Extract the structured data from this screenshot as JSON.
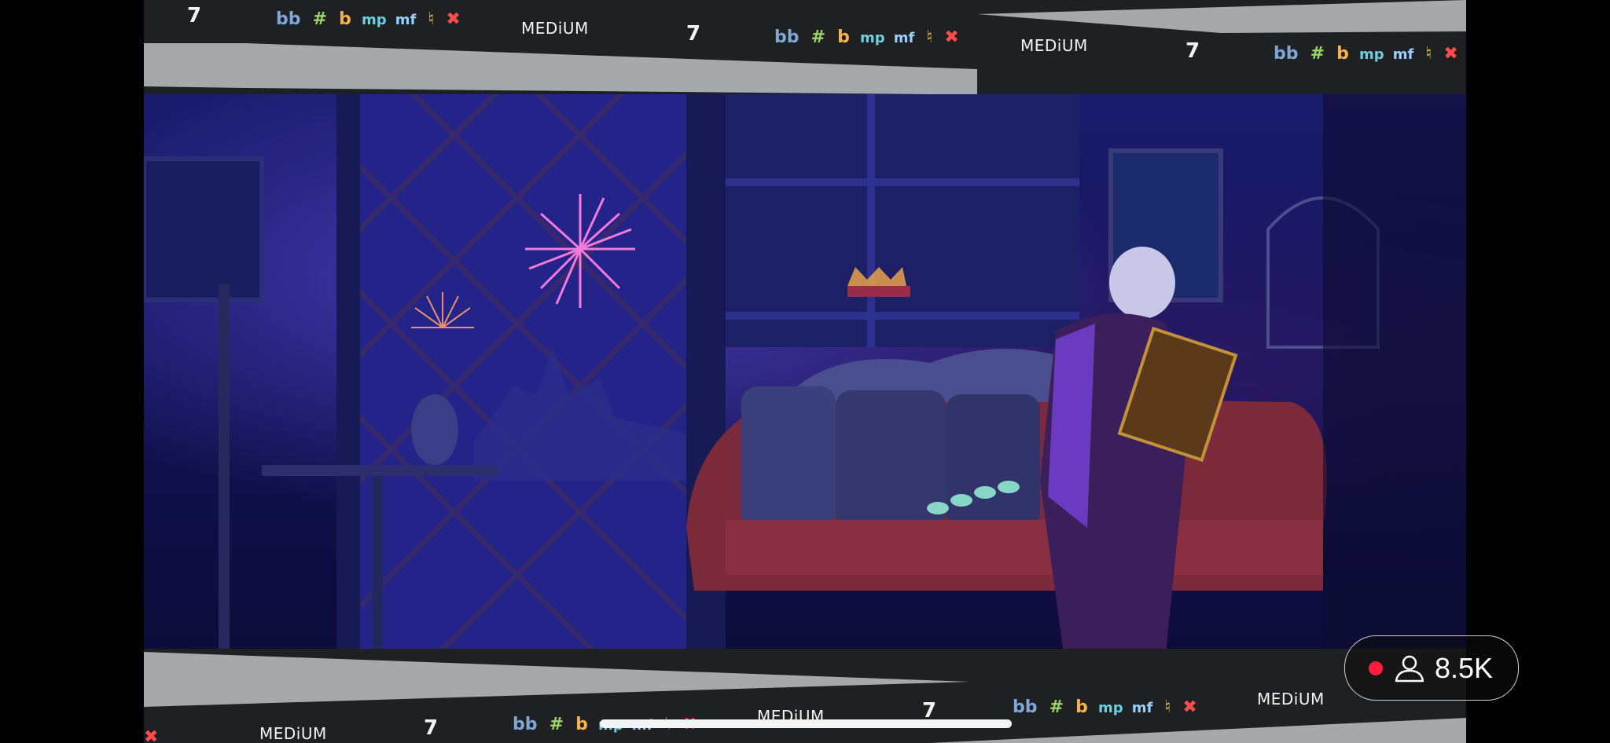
{
  "stream": {
    "viewer_count": "8.5K",
    "live_color": "#ff1f3d",
    "icons": [
      "live-dot-icon",
      "person-icon"
    ]
  },
  "overlay": {
    "medium_label": "MEDiUM",
    "seven_glyph": "7",
    "symbols": [
      "bb",
      "#",
      "b",
      "mp",
      "mf",
      "♮",
      "✖"
    ],
    "symbol_colors": [
      "#7fa8d8",
      "#9bd36b",
      "#f3b24d",
      "#6ecfe0",
      "#9ad0ff",
      "#f1d04c",
      "#ff4d4d"
    ]
  }
}
